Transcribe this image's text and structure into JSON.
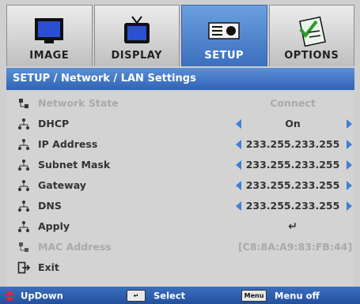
{
  "tabs": [
    {
      "label": "IMAGE",
      "icon": "monitor-icon",
      "active": false
    },
    {
      "label": "DISPLAY",
      "icon": "tv-icon",
      "active": false
    },
    {
      "label": "SETUP",
      "icon": "projector-icon",
      "active": true
    },
    {
      "label": "OPTIONS",
      "icon": "checklist-icon",
      "active": false
    }
  ],
  "breadcrumb": "SETUP / Network / LAN Settings",
  "rows": [
    {
      "label": "Network State",
      "value": "Connect",
      "disabled": true
    },
    {
      "label": "DHCP",
      "value": "On"
    },
    {
      "label": "IP Address",
      "value": "233.255.233.255"
    },
    {
      "label": "Subnet Mask",
      "value": "233.255.233.255"
    },
    {
      "label": "Gateway",
      "value": "233.255.233.255"
    },
    {
      "label": "DNS",
      "value": "233.255.233.255"
    },
    {
      "label": "Apply",
      "value": "↵"
    },
    {
      "label": "MAC Address",
      "value": "[C8:8A:A9:83:FB:44]",
      "disabled": true
    },
    {
      "label": "Exit",
      "value": ""
    }
  ],
  "hints": {
    "updown": "UpDown",
    "select_key": "↵",
    "select": "Select",
    "menu_key": "Menu",
    "menu": "Menu off"
  },
  "colors": {
    "accent": "#3f7fd6",
    "header_blue": "#3163b6",
    "panel_bg": "#d3d3d3",
    "disabled_text": "#a9a9a9"
  }
}
